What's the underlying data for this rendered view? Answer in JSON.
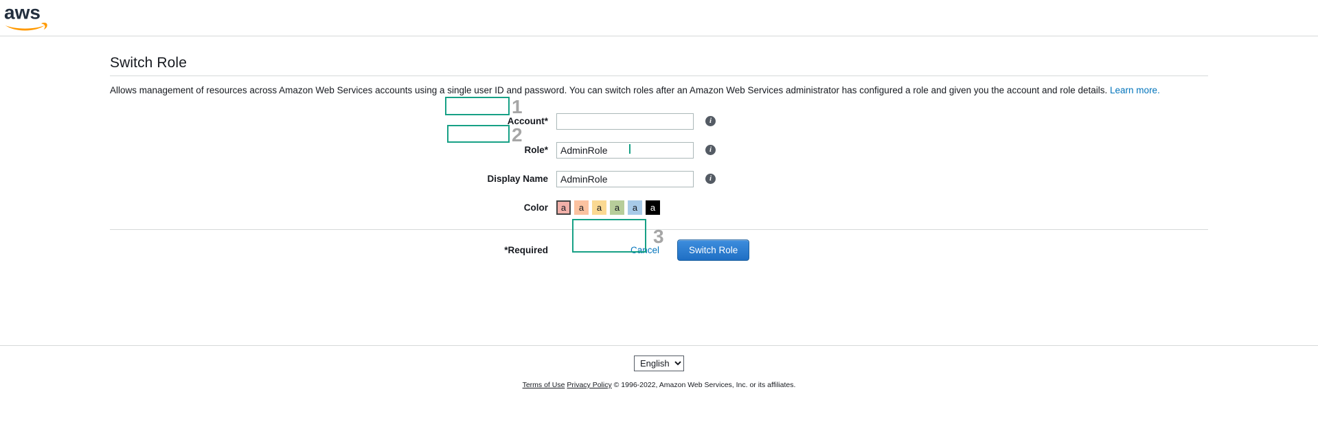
{
  "header": {
    "logo_alt": "aws"
  },
  "page": {
    "title": "Switch Role",
    "description_before_link": "Allows management of resources across Amazon Web Services accounts using a single user ID and password. You can switch roles after an Amazon Web Services administrator has configured a role and given you the account and role details. ",
    "learn_more_label": "Learn more."
  },
  "form": {
    "account": {
      "label": "Account*",
      "value": "",
      "placeholder": "",
      "info_icon": "info-icon"
    },
    "role": {
      "label": "Role*",
      "value": "AdminRole",
      "placeholder": "",
      "info_icon": "info-icon"
    },
    "display_name": {
      "label": "Display Name",
      "value": "AdminRole",
      "placeholder": "",
      "info_icon": "info-icon"
    },
    "color": {
      "label": "Color",
      "swatch_glyph": "a",
      "selected_index": 0,
      "swatches": [
        {
          "name": "salmon",
          "hex": "#f2b0a9",
          "text_hex": "#16191f"
        },
        {
          "name": "peach",
          "hex": "#fbc2a0",
          "text_hex": "#16191f"
        },
        {
          "name": "yellow",
          "hex": "#fad992",
          "text_hex": "#16191f"
        },
        {
          "name": "green",
          "hex": "#b7cd9a",
          "text_hex": "#16191f"
        },
        {
          "name": "blue",
          "hex": "#a7cae8",
          "text_hex": "#16191f"
        },
        {
          "name": "black",
          "hex": "#000000",
          "text_hex": "#ffffff"
        }
      ]
    }
  },
  "actions": {
    "required_note": "*Required",
    "cancel_label": "Cancel",
    "submit_label": "Switch Role"
  },
  "annotations": {
    "accent_hex": "#16a085",
    "number_hex": "#a6a6a6",
    "steps": [
      {
        "number": "1",
        "target": "account-input"
      },
      {
        "number": "2",
        "target": "role-input"
      },
      {
        "number": "3",
        "target": "switch-role-button"
      }
    ]
  },
  "footer": {
    "language_selected": "English",
    "language_options": [
      "English"
    ],
    "terms_label": "Terms of Use",
    "privacy_label": "Privacy Policy",
    "copyright": "© 1996-2022, Amazon Web Services, Inc. or its affiliates."
  }
}
